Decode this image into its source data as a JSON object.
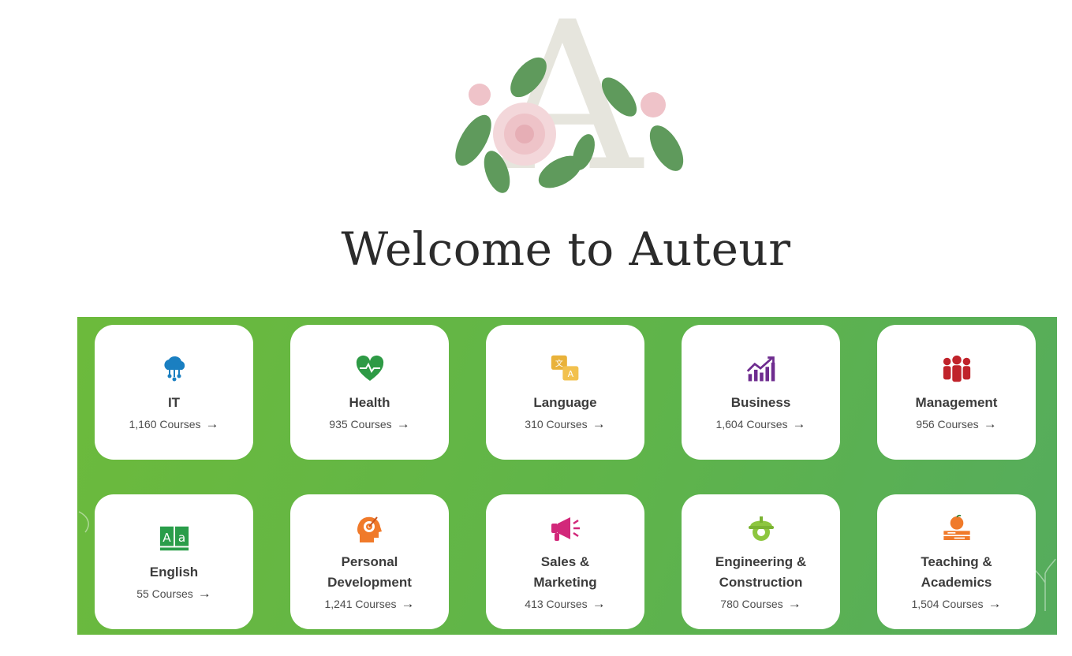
{
  "header": {
    "title": "Welcome to Auteur",
    "logo_letter": "A"
  },
  "categories": [
    {
      "name": "IT",
      "count": "1,160 Courses",
      "icon": "cloud-network-icon",
      "color": "#1a7fc1"
    },
    {
      "name": "Health",
      "count": "935 Courses",
      "icon": "heartbeat-icon",
      "color": "#2e9a45"
    },
    {
      "name": "Language",
      "count": "310 Courses",
      "icon": "translate-icon",
      "color": "#e9b23a"
    },
    {
      "name": "Business",
      "count": "1,604 Courses",
      "icon": "growth-chart-icon",
      "color": "#6e2c8f"
    },
    {
      "name": "Management",
      "count": "956 Courses",
      "icon": "team-icon",
      "color": "#c0232b"
    },
    {
      "name": "English",
      "count": "55 Courses",
      "icon": "book-aa-icon",
      "color": "#2a9d4a"
    },
    {
      "name": "Personal Development",
      "count": "1,241 Courses",
      "icon": "target-head-icon",
      "color": "#f07a2a"
    },
    {
      "name": "Sales & Marketing",
      "count": "413 Courses",
      "icon": "megaphone-icon",
      "color": "#d2287a"
    },
    {
      "name": "Engineering & Construction",
      "count": "780 Courses",
      "icon": "hardhat-gear-icon",
      "color": "#8dc63f"
    },
    {
      "name": "Teaching & Academics",
      "count": "1,504 Courses",
      "icon": "apple-books-icon",
      "color": "#f07a2a"
    }
  ],
  "arrow_glyph": "→"
}
